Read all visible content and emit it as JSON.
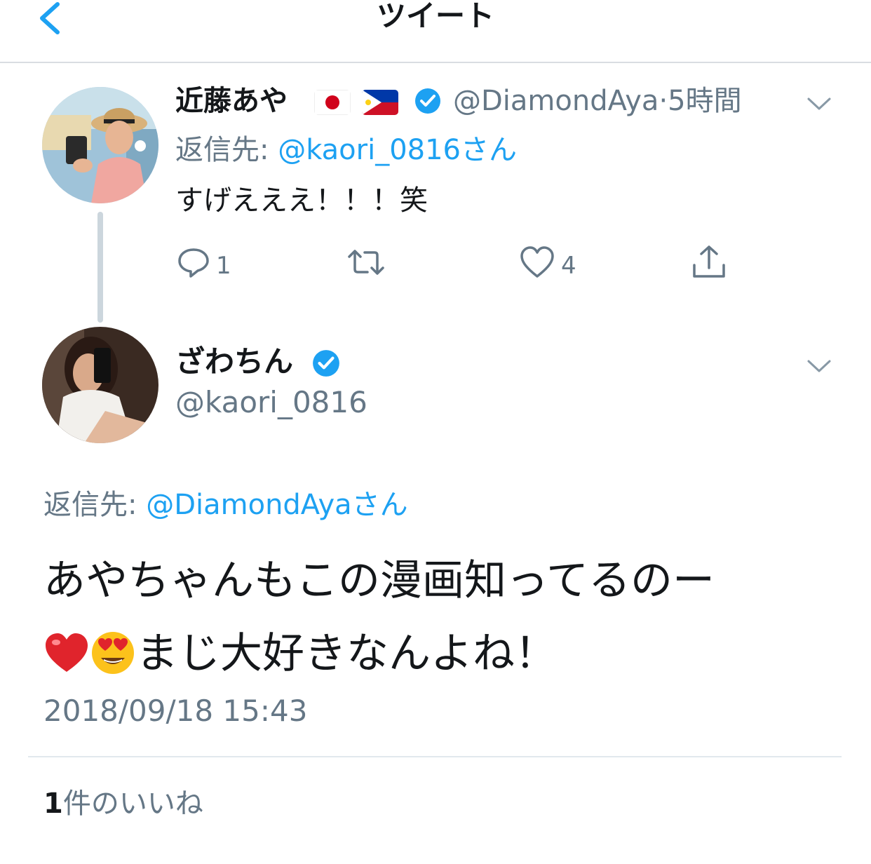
{
  "nav": {
    "title": "ツイート",
    "back_icon": "chevron-left-icon"
  },
  "parent_tweet": {
    "display_name": "近藤あや",
    "flags": [
      "japan-flag-icon",
      "philippines-flag-icon"
    ],
    "verified": true,
    "handle": "@DiamondAya",
    "separator": "·",
    "time": "5時間",
    "reply_prefix": "返信先: ",
    "reply_to": "@kaori_0816さん",
    "text": "すげえええ！！！笑",
    "actions": {
      "reply_count": "1",
      "retweet_count": "",
      "like_count": "4"
    }
  },
  "main_tweet": {
    "display_name": "ざわちん",
    "verified": true,
    "handle": "@kaori_0816",
    "reply_prefix": "返信先: ",
    "reply_to": "@DiamondAyaさん",
    "text_line1": "あやちゃんもこの漫画知ってるのー",
    "text_line2": "まじ大好きなんよね！",
    "emojis": [
      "red-heart-emoji",
      "heart-eyes-emoji"
    ],
    "timestamp": "2018/09/18 15:43"
  },
  "likes": {
    "count": "1",
    "label": "件のいいね"
  },
  "colors": {
    "accent": "#1da1f2",
    "secondary_text": "#657786",
    "primary_text": "#14171a",
    "divider": "#e1e8ed"
  }
}
